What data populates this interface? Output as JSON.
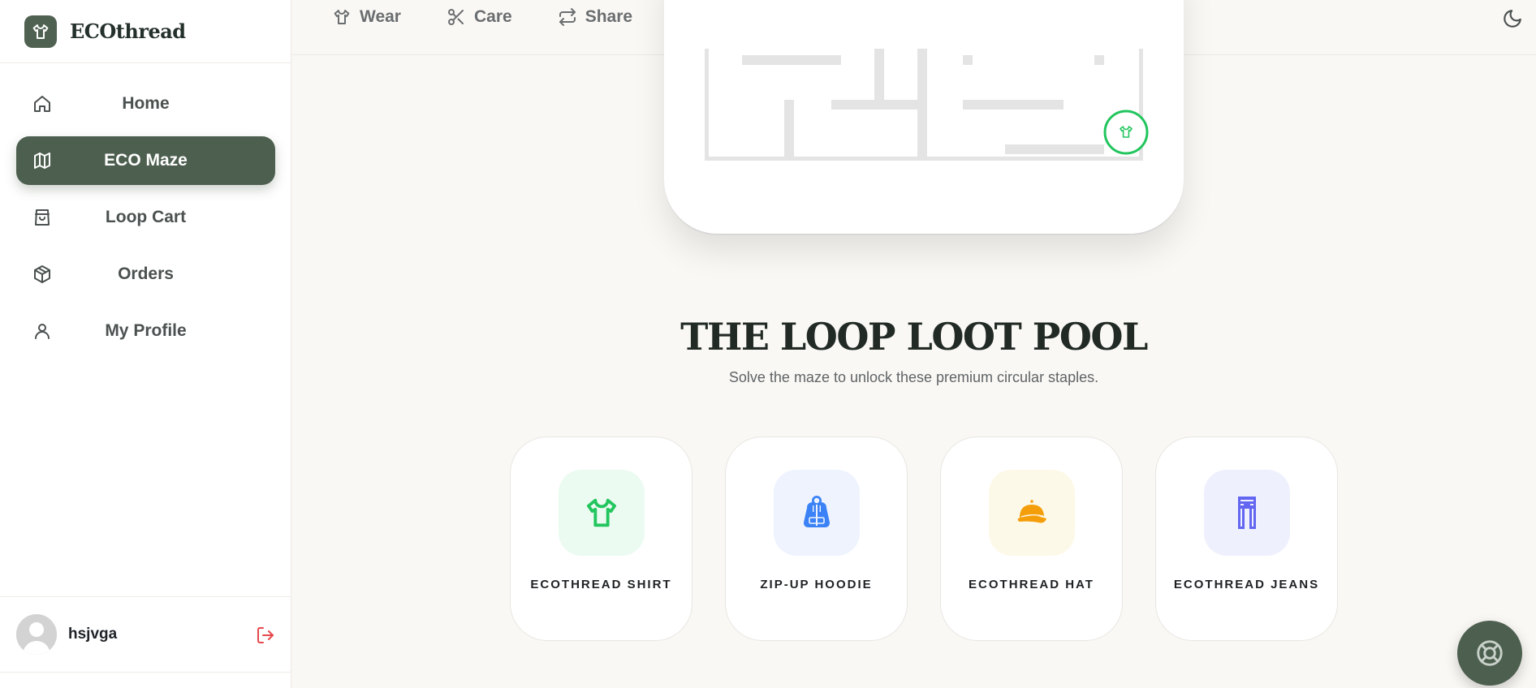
{
  "brand": {
    "name": "ECOthread",
    "logo_icon": "shirt-icon",
    "accent_color": "#4d5f4f"
  },
  "sidebar": {
    "items": [
      {
        "label": "Home",
        "icon": "home-icon",
        "active": false
      },
      {
        "label": "ECO Maze",
        "icon": "map-icon",
        "active": true
      },
      {
        "label": "Loop Cart",
        "icon": "shopping-bag-icon",
        "active": false
      },
      {
        "label": "Orders",
        "icon": "package-icon",
        "active": false
      },
      {
        "label": "My Profile",
        "icon": "user-icon",
        "active": false
      }
    ],
    "user": {
      "name": "hsjvga",
      "logout_icon": "logout-icon",
      "logout_color": "#e5484d"
    }
  },
  "topbar": {
    "links": [
      {
        "label": "Wear",
        "icon": "shirt-icon"
      },
      {
        "label": "Care",
        "icon": "scissors-icon"
      },
      {
        "label": "Share",
        "icon": "repeat-icon"
      }
    ],
    "theme_icon": "moon-icon"
  },
  "maze": {
    "goal_icon": "shirt-icon",
    "goal_color": "#22c55e"
  },
  "pool": {
    "title": "THE LOOP LOOT POOL",
    "subtitle": "Solve the maze to unlock these premium circular staples.",
    "items": [
      {
        "label": "ECOTHREAD SHIRT",
        "icon": "shirt-icon",
        "color": "#22c55e",
        "bg": "#ecfbf1"
      },
      {
        "label": "ZIP-UP HOODIE",
        "icon": "hoodie-icon",
        "color": "#3b82f6",
        "bg": "#eef3fe"
      },
      {
        "label": "ECOTHREAD HAT",
        "icon": "cap-icon",
        "color": "#f59e0b",
        "bg": "#fdf9e8"
      },
      {
        "label": "ECOTHREAD JEANS",
        "icon": "jeans-icon",
        "color": "#6366f1",
        "bg": "#eef0fd"
      }
    ]
  },
  "fab": {
    "icon": "lifebuoy-icon"
  }
}
